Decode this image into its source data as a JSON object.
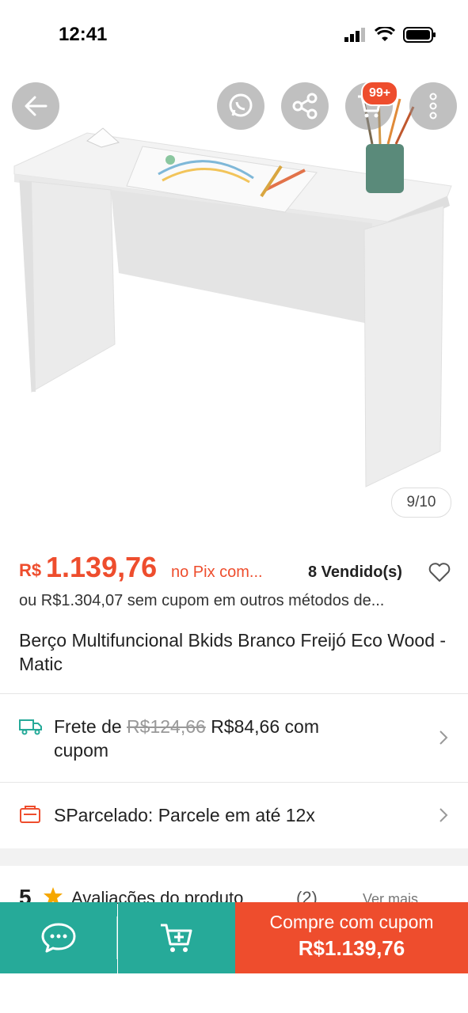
{
  "status_bar": {
    "time": "12:41"
  },
  "hero": {
    "cart_badge": "99+",
    "image_counter": "9/10"
  },
  "price": {
    "currency": "R$",
    "value": "1.139,76",
    "pix_label": "no Pix com...",
    "sold": "8 Vendido(s)",
    "alt_price_text": "ou R$1.304,07 sem cupom em outros métodos de..."
  },
  "product": {
    "title": "Berço Multifuncional Bkids Branco Freijó Eco Wood - Matic"
  },
  "shipping": {
    "prefix": "Frete de",
    "old_price": "R$124,66",
    "new_price_line": "R$84,66 com",
    "suffix": "cupom"
  },
  "installments": {
    "label": "SParcelado: Parcele em até 12x"
  },
  "reviews": {
    "rating": "5",
    "label": "Avaliações do produto",
    "count": "(2)",
    "see_more": "Ver mais"
  },
  "bottom_bar": {
    "buy_label": "Compre com cupom",
    "buy_price": "R$1.139,76"
  },
  "colors": {
    "accent": "#ee4d2d",
    "teal": "#26aa99"
  }
}
